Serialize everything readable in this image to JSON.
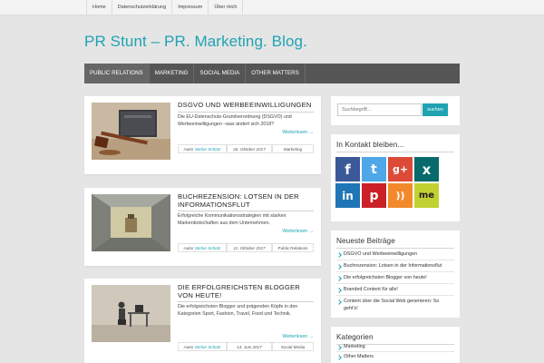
{
  "topnav": [
    "Home",
    "Datenschutzerklärung",
    "Impressum",
    "Über mich"
  ],
  "site": {
    "title": "PR Stunt – PR. Marketing. Blog."
  },
  "mainnav": [
    "PUBLIC RELATIONS",
    "MARKETING",
    "SOCIAL MEDIA",
    "OTHER MATTERS"
  ],
  "posts": [
    {
      "title": "DSGVO UND WERBEEINWILLIGUNGEN",
      "excerpt": "Die EU-Datenschutz-Grundverordnung (DSGVO) und Werbeeinwilligungen –was ändert sich 2018?",
      "readmore": "Weiterlesen →",
      "author_prefix": "Autor",
      "author": "Stefan Schütz",
      "date": "26. Oktober 2017",
      "category": "Marketing",
      "image": "gavel-on-book"
    },
    {
      "title": "BUCHREZENSION: LOTSEN IN DER INFORMATIONSFLUT",
      "excerpt": "Erfolgreiche Kommunikationsstrategien mit starken Markenbotschaften aus dem Unternehmen.",
      "readmore": "Weiterlesen →",
      "author_prefix": "Autor",
      "author": "Stefan Schütz",
      "date": "11. Oktober 2017",
      "category": "Public Relations",
      "image": "box-room"
    },
    {
      "title": "DIE ERFOLGREICHSTEN BLOGGER VON HEUTE!",
      "excerpt": "Die erfolgreichsten Blogger und prägenden Köpfe in den Kategorien Sport, Fashion, Travel, Food und Technik.",
      "readmore": "Weiterlesen →",
      "author_prefix": "Autor",
      "author": "Stefan Schütz",
      "date": "14. Juni 2017",
      "category": "Social Media",
      "image": "figure-at-desk"
    }
  ],
  "search": {
    "placeholder": "Suchbegriff...",
    "button": "suchen"
  },
  "contact": {
    "title": "In Kontakt bleiben...",
    "icons": [
      {
        "name": "facebook",
        "glyph": "f",
        "color": "#3b5998"
      },
      {
        "name": "twitter",
        "glyph": "t",
        "color": "#4fa7e8"
      },
      {
        "name": "google-plus",
        "glyph": "g+",
        "color": "#dc4a38"
      },
      {
        "name": "xing",
        "glyph": "x",
        "color": "#086a6a"
      },
      {
        "name": "linkedin",
        "glyph": "in",
        "color": "#1f75b5"
      },
      {
        "name": "pinterest",
        "glyph": "p",
        "color": "#cb2027"
      },
      {
        "name": "rss",
        "glyph": "))",
        "color": "#f2892b"
      },
      {
        "name": "meetup",
        "glyph": "me",
        "color": "#c2d132"
      }
    ]
  },
  "recent": {
    "title": "Neueste Beiträge",
    "items": [
      "DSGVO und Werbeeinwilligungen",
      "Buchrezension: Lotsen in der Informationsflut",
      "Die erfolgreichsten Blogger von heute!",
      "Branded Content für alle!",
      "Content über die Social Web generieren: So geht's!"
    ]
  },
  "categories": {
    "title": "Kategorien",
    "items": [
      "Marketing",
      "Other Matters"
    ]
  },
  "colors": {
    "accent": "#1fa3b2",
    "nav": "#555555",
    "background": "#e5e5e5"
  }
}
